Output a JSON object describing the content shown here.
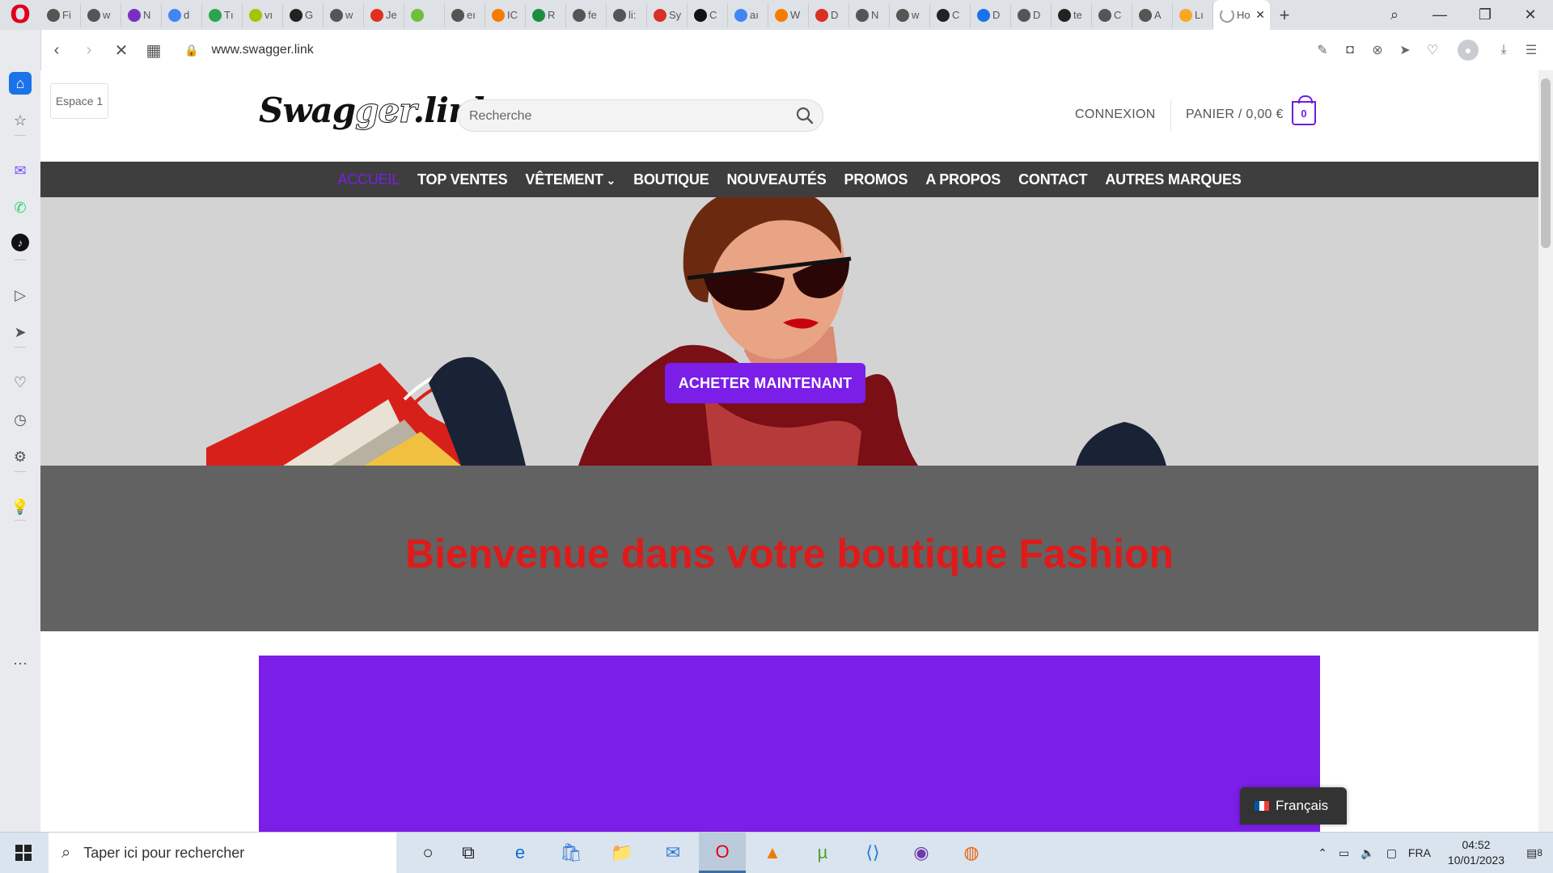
{
  "browser": {
    "tabs": [
      {
        "label": "Fi",
        "icon": "web-icon",
        "color": "#555555"
      },
      {
        "label": "w",
        "icon": "web-icon",
        "color": "#555555"
      },
      {
        "label": "N",
        "icon": "n-icon",
        "color": "#7b2fbf"
      },
      {
        "label": "d",
        "icon": "google-icon",
        "color": "#4285f4"
      },
      {
        "label": "Tı",
        "icon": "star-icon",
        "color": "#2da44e"
      },
      {
        "label": "vı",
        "icon": "ball-icon",
        "color": "#a4c400"
      },
      {
        "label": "G",
        "icon": "github-icon",
        "color": "#222222"
      },
      {
        "label": "w",
        "icon": "web-icon",
        "color": "#555555"
      },
      {
        "label": "Je",
        "icon": "heart-icon",
        "color": "#e0301e"
      },
      {
        "label": "",
        "icon": "app-icon",
        "color": "#6fbf3b"
      },
      {
        "label": "eı",
        "icon": "web-icon",
        "color": "#555555"
      },
      {
        "label": "IC",
        "icon": "chart-icon",
        "color": "#f57c00"
      },
      {
        "label": "R",
        "icon": "r-icon",
        "color": "#1e8e3e"
      },
      {
        "label": "fe",
        "icon": "web-icon",
        "color": "#555555"
      },
      {
        "label": "li:",
        "icon": "web-icon",
        "color": "#555555"
      },
      {
        "label": "Sy",
        "icon": "y-icon",
        "color": "#d93025"
      },
      {
        "label": "C",
        "icon": "m-icon",
        "color": "#111111"
      },
      {
        "label": "aı",
        "icon": "google-icon",
        "color": "#4285f4"
      },
      {
        "label": "W",
        "icon": "w-icon",
        "color": "#f57c00"
      },
      {
        "label": "D",
        "icon": "d-icon",
        "color": "#d93025"
      },
      {
        "label": "N",
        "icon": "web-icon",
        "color": "#555555"
      },
      {
        "label": "w",
        "icon": "web-icon",
        "color": "#555555"
      },
      {
        "label": "C",
        "icon": "codepen-icon",
        "color": "#222222"
      },
      {
        "label": "D",
        "icon": "flag-icon",
        "color": "#1a73e8"
      },
      {
        "label": "D",
        "icon": "web-icon",
        "color": "#555555"
      },
      {
        "label": "te",
        "icon": "codepen-icon",
        "color": "#222222"
      },
      {
        "label": "C",
        "icon": "web-icon",
        "color": "#555555"
      },
      {
        "label": "A",
        "icon": "grid-icon",
        "color": "#555555"
      },
      {
        "label": "Lı",
        "icon": "bulb-icon",
        "color": "#f9a825"
      }
    ],
    "active_tab": {
      "label": "Ho",
      "icon": "loading-icon"
    },
    "url": "www.swagger.link"
  },
  "sidebar": {
    "items": [
      {
        "name": "home-icon",
        "glyph": "⌂"
      },
      {
        "name": "bookmarks-icon",
        "glyph": "☆"
      },
      {
        "name": "messenger-icon",
        "glyph": "✉"
      },
      {
        "name": "whatsapp-icon",
        "glyph": "✆"
      },
      {
        "name": "tiktok-icon",
        "glyph": "♪"
      },
      {
        "name": "player-icon",
        "glyph": "▷"
      },
      {
        "name": "send-icon",
        "glyph": "➤"
      },
      {
        "name": "heart-icon",
        "glyph": "♡"
      },
      {
        "name": "history-icon",
        "glyph": "◷"
      },
      {
        "name": "settings-icon",
        "glyph": "⚙"
      },
      {
        "name": "tips-icon",
        "glyph": "💡"
      },
      {
        "name": "more-icon",
        "glyph": "⋯"
      }
    ]
  },
  "page": {
    "workspace_label": "Espace 1",
    "logo": {
      "part1": "Swag",
      "part2": "ger",
      "part3": ".link"
    },
    "search": {
      "placeholder": "Recherche"
    },
    "login": "CONNEXION",
    "cart": {
      "label": "PANIER / 0,00 €",
      "count": "0"
    },
    "nav": [
      {
        "label": "ACCUEIL",
        "active": true
      },
      {
        "label": "TOP VENTES",
        "active": false
      },
      {
        "label": "VÊTEMENT",
        "active": false,
        "dropdown": true
      },
      {
        "label": "BOUTIQUE",
        "active": false
      },
      {
        "label": "NOUVEAUTÉS",
        "active": false
      },
      {
        "label": "PROMOS",
        "active": false
      },
      {
        "label": "A PROPOS",
        "active": false
      },
      {
        "label": "CONTACT",
        "active": false
      },
      {
        "label": "AUTRES MARQUES",
        "active": false
      }
    ],
    "hero": {
      "cta": "ACHETER MAINTENANT"
    },
    "welcome_title": "Bienvenue dans votre boutique Fashion",
    "language": "Français",
    "colors": {
      "accent": "#7a1ee8",
      "nav_bg": "#3e3e3e",
      "hero_bg": "#d3d3d3",
      "welcome_bg": "#626262",
      "welcome_text": "#e01a1a"
    }
  },
  "taskbar": {
    "search_placeholder": "Taper ici pour rechercher",
    "apps": [
      {
        "name": "cortana-icon",
        "glyph": "○"
      },
      {
        "name": "task-view-icon",
        "glyph": "⧉"
      },
      {
        "name": "edge-icon",
        "glyph": "e"
      },
      {
        "name": "store-icon",
        "glyph": "🛍"
      },
      {
        "name": "file-explorer-icon",
        "glyph": "📁"
      },
      {
        "name": "mail-icon",
        "glyph": "✉"
      },
      {
        "name": "opera-icon",
        "glyph": "O"
      },
      {
        "name": "vlc-icon",
        "glyph": "▲"
      },
      {
        "name": "utorrent-icon",
        "glyph": "µ"
      },
      {
        "name": "vscode-icon",
        "glyph": "⟨⟩"
      },
      {
        "name": "github-desktop-icon",
        "glyph": "◉"
      },
      {
        "name": "firefox-icon",
        "glyph": "◍"
      }
    ],
    "language": "FRA",
    "time": "04:52",
    "date": "10/01/2023",
    "notifications": "8"
  }
}
